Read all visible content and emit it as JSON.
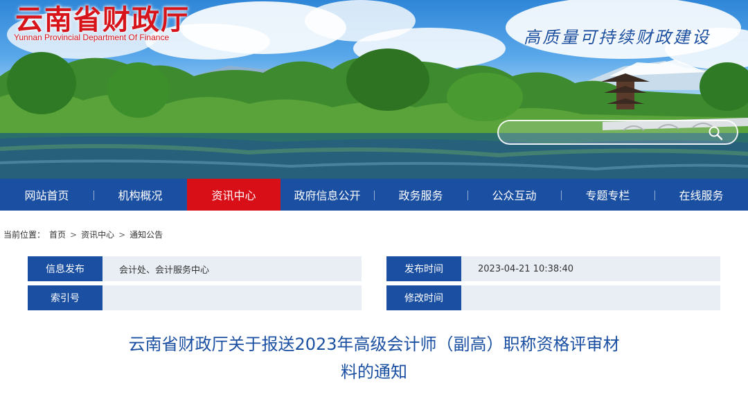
{
  "header": {
    "site_title": "云南省财政厅",
    "site_subtitle": "Yunnan Provincial Department Of Finance",
    "slogan": "高质量可持续财政建设",
    "search": {
      "placeholder": "",
      "button_icon": "search-icon"
    }
  },
  "nav": {
    "items": [
      {
        "label": "网站首页",
        "active": false
      },
      {
        "label": "机构概况",
        "active": false
      },
      {
        "label": "资讯中心",
        "active": true
      },
      {
        "label": "政府信息公开",
        "active": false
      },
      {
        "label": "政务服务",
        "active": false
      },
      {
        "label": "公众互动",
        "active": false
      },
      {
        "label": "专题专栏",
        "active": false
      },
      {
        "label": "在线服务",
        "active": false
      }
    ]
  },
  "breadcrumb": {
    "prefix": "当前位置：",
    "items": [
      "首页",
      "资讯中心",
      "通知公告"
    ],
    "separator": ">"
  },
  "meta": {
    "publisher_label": "信息发布",
    "publisher_value": "会计处、会计服务中心",
    "publish_time_label": "发布时间",
    "publish_time_value": "2023-04-21 10:38:40",
    "index_label": "索引号",
    "index_value": "",
    "modify_time_label": "修改时间",
    "modify_time_value": ""
  },
  "article": {
    "title_line1": "云南省财政厅关于报送2023年高级会计师（副高）职称资格评审材",
    "title_line2": "料的通知"
  },
  "colors": {
    "nav_bg": "#1a4fa2",
    "nav_active": "#d90f18",
    "title_red": "#d8141b",
    "label_bg": "#1a4fa2",
    "value_bg": "#e9eef5"
  }
}
